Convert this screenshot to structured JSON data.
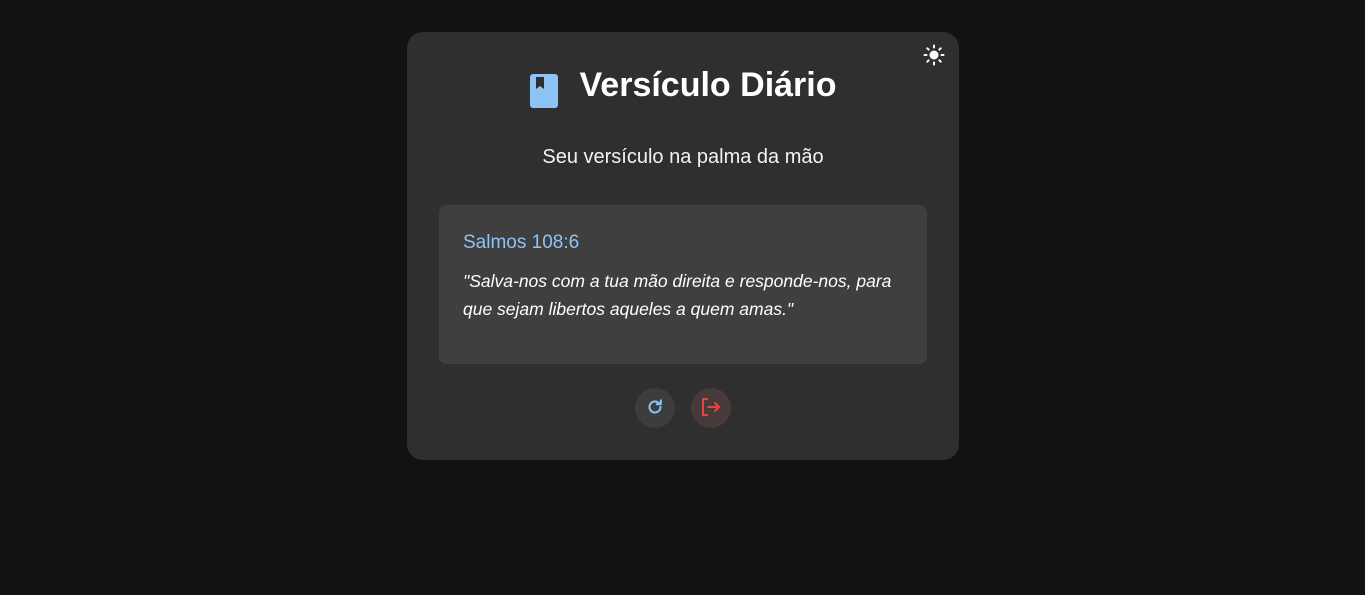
{
  "header": {
    "title": "Versículo Diário",
    "subtitle": "Seu versículo na palma da mão",
    "book_icon": "bookmark-book-icon",
    "theme_toggle_icon": "sun-icon"
  },
  "verse": {
    "reference": "Salmos 108:6",
    "text": "\"Salva-nos com a tua mão direita e responde-nos, para que sejam libertos aqueles a quem amas.\""
  },
  "actions": {
    "refresh_icon": "refresh-icon",
    "logout_icon": "logout-icon"
  },
  "colors": {
    "background": "#121212",
    "card": "#2f2f2f",
    "verse_box": "#3f3f3f",
    "accent_blue": "#8ec4f5",
    "logout_red": "#e5473c"
  }
}
